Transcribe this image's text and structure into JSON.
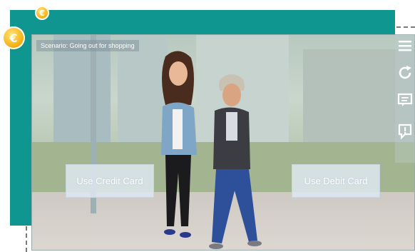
{
  "scenario": {
    "label": "Scenario: Going out for shopping"
  },
  "options": {
    "credit": "Use Credit Card",
    "debit": "Use Debit Card"
  },
  "coins": {
    "small": "€",
    "large": "€"
  },
  "toolbar": {
    "icons": [
      "menu-icon",
      "refresh-icon",
      "transcript-icon",
      "alert-icon"
    ]
  },
  "colors": {
    "frame": "#0f9690",
    "coin": "#f6b51a",
    "button": "#dee8f0"
  }
}
